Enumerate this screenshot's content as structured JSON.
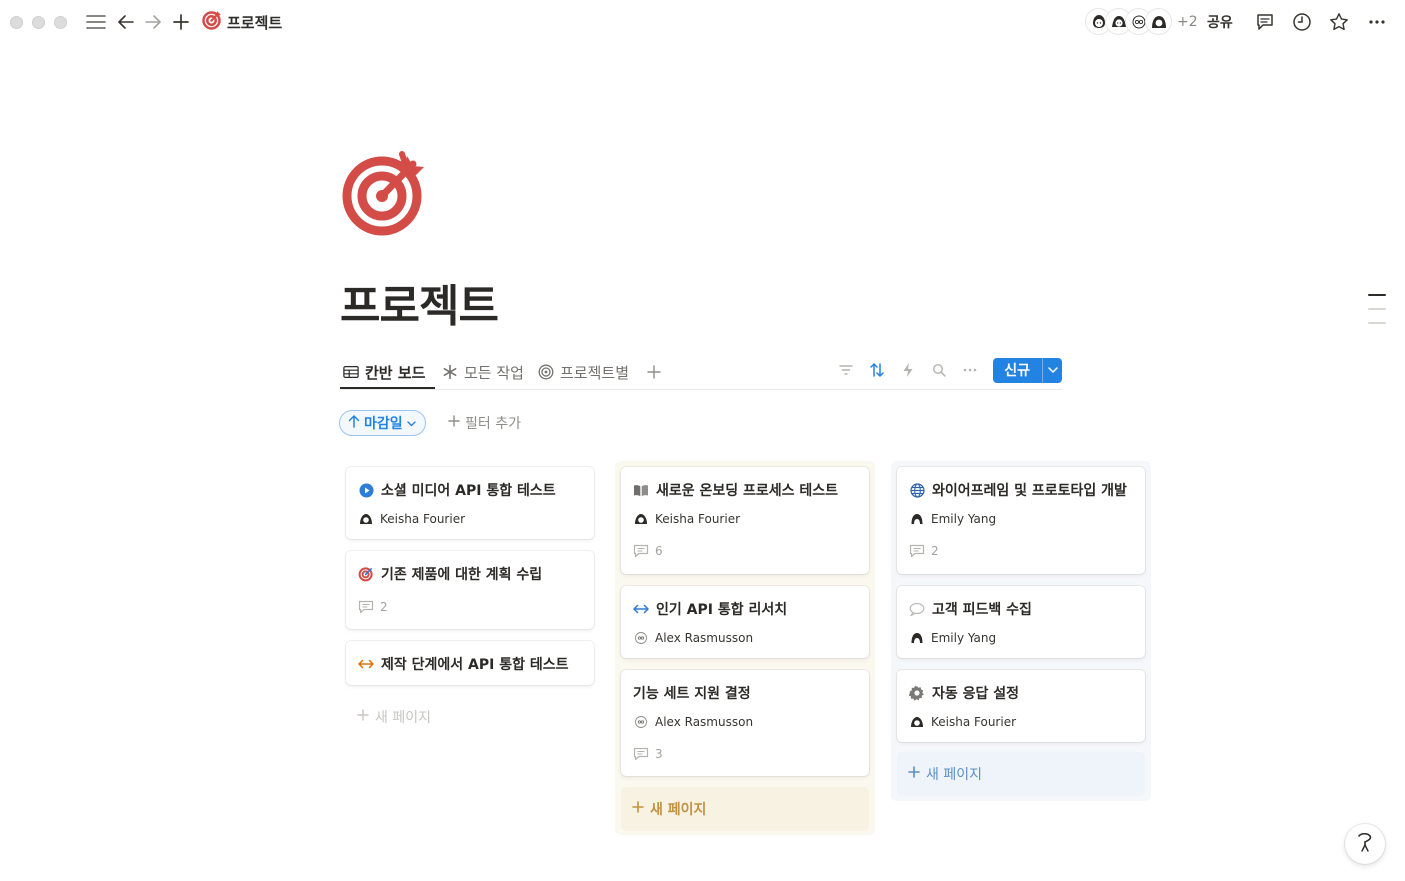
{
  "window": {
    "breadcrumb_title": "프로젝트",
    "collaborators_extra": "+2",
    "share_label": "공유"
  },
  "page": {
    "title": "프로젝트",
    "icon": "target-icon",
    "accent_color": "#d44c47"
  },
  "views": {
    "tabs": [
      {
        "label": "칸반 보드",
        "icon": "table-icon",
        "active": true
      },
      {
        "label": "모든 작업",
        "icon": "asterisk-icon",
        "active": false
      },
      {
        "label": "프로젝트별",
        "icon": "target-outline-icon",
        "active": false
      }
    ],
    "new_button_label": "신규",
    "new_button_color": "#2383e2"
  },
  "filters": {
    "sort_label": "마감일",
    "add_filter_label": "필터 추가"
  },
  "board": {
    "columns": [
      {
        "background": "#ffffff",
        "new_page_label": "새 페이지",
        "new_page_color": "#c7c6c3",
        "cards": [
          {
            "title": "소셜 미디어 API 통합 테스트",
            "icon": "play-circle-icon",
            "person": "Keisha Fourier",
            "comments": null
          },
          {
            "title": "기존 제품에 대한 계획 수립",
            "icon": "target-icon",
            "person": null,
            "comments": "2"
          },
          {
            "title": "제작 단계에서 API 통합 테스트",
            "icon": "arrows-horizontal-icon",
            "person": null,
            "comments": null
          }
        ]
      },
      {
        "background": "#fbf8ef",
        "new_page_label": "새 페이지",
        "new_page_color": "#c29243",
        "cards": [
          {
            "title": "새로운 온보딩 프로세스 테스트",
            "icon": "book-icon",
            "person": "Keisha Fourier",
            "comments": "6"
          },
          {
            "title": "인기 API 통합 리서치",
            "icon": "arrows-horizontal-icon",
            "person": "Alex Rasmusson",
            "comments": null
          },
          {
            "title": "기능 세트 지원 결정",
            "icon": null,
            "person": "Alex Rasmusson",
            "comments": "3"
          }
        ]
      },
      {
        "background": "#f5f8fb",
        "new_page_label": "새 페이지",
        "new_page_color": "#5b8fc7",
        "cards": [
          {
            "title": "와이어프레임 및 프로토타입 개발",
            "icon": "globe-icon",
            "person": "Emily Yang",
            "comments": "2"
          },
          {
            "title": "고객 피드백 수집",
            "icon": "speech-bubble-icon",
            "person": "Emily Yang",
            "comments": null
          },
          {
            "title": "자동 응답 설정",
            "icon": "gear-icon",
            "person": "Keisha Fourier",
            "comments": null
          }
        ]
      }
    ]
  }
}
